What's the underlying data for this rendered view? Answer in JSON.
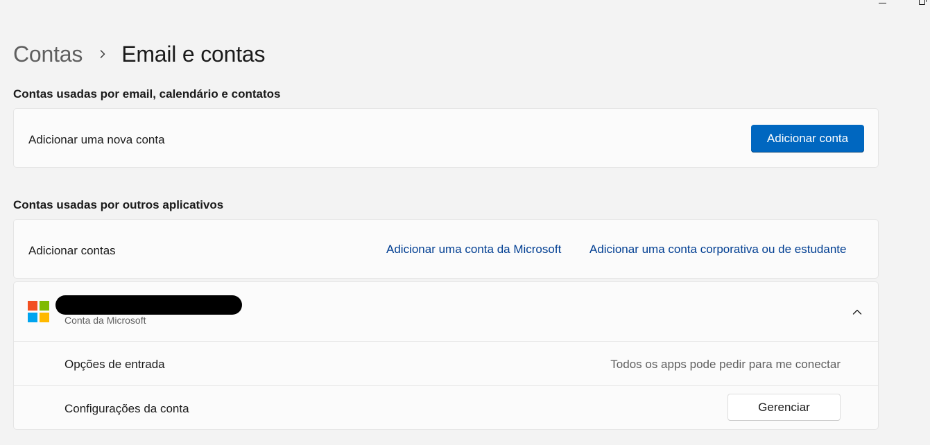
{
  "breadcrumb": {
    "parent": "Contas",
    "current": "Email e contas"
  },
  "section_email": {
    "title": "Contas usadas por email, calendário e contatos",
    "add_label": "Adicionar uma nova conta",
    "add_button": "Adicionar conta"
  },
  "section_apps": {
    "title": "Contas usadas por outros aplicativos",
    "add_label": "Adicionar contas",
    "link_microsoft": "Adicionar uma conta da Microsoft",
    "link_work": "Adicionar uma conta corporativa ou de estudante"
  },
  "account": {
    "type": "Conta da Microsoft",
    "expanded": true,
    "signin_label": "Opções de entrada",
    "signin_value": "Todos os apps pode pedir para me conectar",
    "settings_label": "Configurações da conta",
    "manage_button": "Gerenciar"
  },
  "colors": {
    "accent": "#0067c0",
    "link": "#003e92",
    "background": "#f3f3f3",
    "card": "#fbfbfb",
    "logo_red": "#f25022",
    "logo_green": "#7fba00",
    "logo_blue": "#00a4ef",
    "logo_yellow": "#ffb900"
  },
  "icons": {
    "breadcrumb_separator": "chevron-right-icon",
    "account_logo": "microsoft-logo-icon",
    "expander": "chevron-up-icon",
    "window_minimize": "minimize-icon",
    "window_maximize": "restore-icon"
  }
}
